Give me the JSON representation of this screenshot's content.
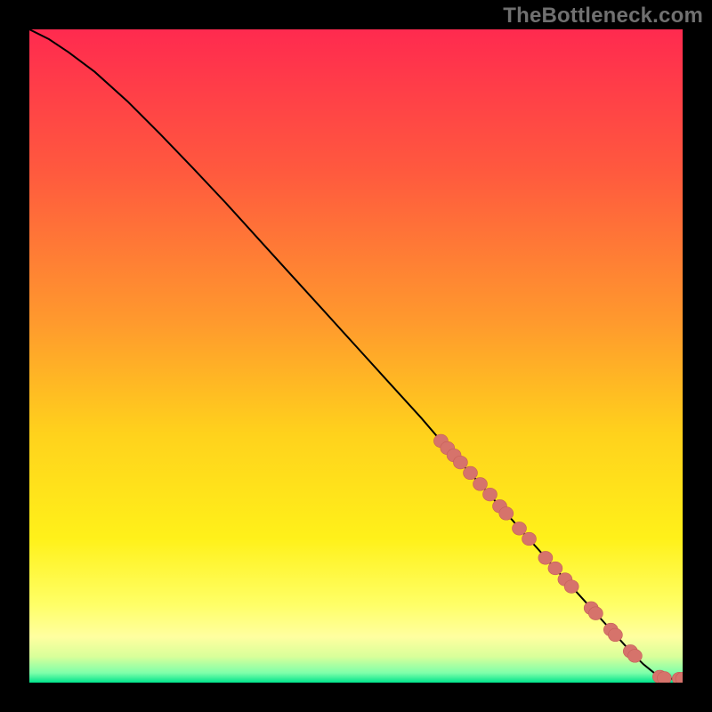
{
  "watermark": "TheBottleneck.com",
  "colors": {
    "curve": "#000000",
    "marker_fill": "#d6736b",
    "marker_stroke": "#c55f58",
    "gradient_stops": [
      {
        "offset": 0.0,
        "color": "#ff2a4f"
      },
      {
        "offset": 0.22,
        "color": "#ff5a3e"
      },
      {
        "offset": 0.45,
        "color": "#ff9a2d"
      },
      {
        "offset": 0.62,
        "color": "#ffd21c"
      },
      {
        "offset": 0.78,
        "color": "#fff11a"
      },
      {
        "offset": 0.88,
        "color": "#ffff66"
      },
      {
        "offset": 0.93,
        "color": "#ffffa0"
      },
      {
        "offset": 0.96,
        "color": "#d9ff9a"
      },
      {
        "offset": 0.985,
        "color": "#7fffaa"
      },
      {
        "offset": 1.0,
        "color": "#00e38c"
      }
    ]
  },
  "chart_data": {
    "type": "line",
    "title": "",
    "xlabel": "",
    "ylabel": "",
    "xlim": [
      0,
      100
    ],
    "ylim": [
      0,
      100
    ],
    "grid": false,
    "legend": false,
    "series": [
      {
        "name": "curve",
        "x": [
          0,
          3,
          6,
          10,
          15,
          20,
          25,
          30,
          35,
          40,
          45,
          50,
          55,
          60,
          63,
          65,
          68,
          70,
          72,
          74,
          76,
          78,
          80,
          82,
          84,
          86,
          88,
          90,
          92,
          94,
          96,
          98,
          100
        ],
        "y": [
          100,
          98.5,
          96.5,
          93.5,
          89.0,
          84.0,
          78.8,
          73.5,
          68.0,
          62.5,
          57.0,
          51.5,
          46.0,
          40.5,
          37.0,
          34.8,
          31.5,
          29.3,
          27.0,
          24.8,
          22.5,
          20.3,
          18.0,
          15.8,
          13.6,
          11.4,
          9.2,
          7.0,
          4.8,
          2.8,
          1.2,
          0.6,
          0.6
        ]
      }
    ],
    "markers": [
      {
        "x": 63.0,
        "y": 37.0
      },
      {
        "x": 64.0,
        "y": 35.9
      },
      {
        "x": 65.0,
        "y": 34.8
      },
      {
        "x": 66.0,
        "y": 33.7
      },
      {
        "x": 67.5,
        "y": 32.1
      },
      {
        "x": 69.0,
        "y": 30.4
      },
      {
        "x": 70.5,
        "y": 28.8
      },
      {
        "x": 72.0,
        "y": 27.0
      },
      {
        "x": 73.0,
        "y": 25.9
      },
      {
        "x": 75.0,
        "y": 23.6
      },
      {
        "x": 76.5,
        "y": 22.0
      },
      {
        "x": 79.0,
        "y": 19.1
      },
      {
        "x": 80.5,
        "y": 17.5
      },
      {
        "x": 82.0,
        "y": 15.8
      },
      {
        "x": 83.0,
        "y": 14.7
      },
      {
        "x": 86.0,
        "y": 11.4
      },
      {
        "x": 86.7,
        "y": 10.6
      },
      {
        "x": 89.0,
        "y": 8.1
      },
      {
        "x": 89.7,
        "y": 7.3
      },
      {
        "x": 92.0,
        "y": 4.8
      },
      {
        "x": 92.7,
        "y": 4.1
      },
      {
        "x": 96.5,
        "y": 0.9
      },
      {
        "x": 97.2,
        "y": 0.7
      },
      {
        "x": 99.5,
        "y": 0.6
      },
      {
        "x": 100.0,
        "y": 0.6
      }
    ],
    "marker_radius": 8
  }
}
